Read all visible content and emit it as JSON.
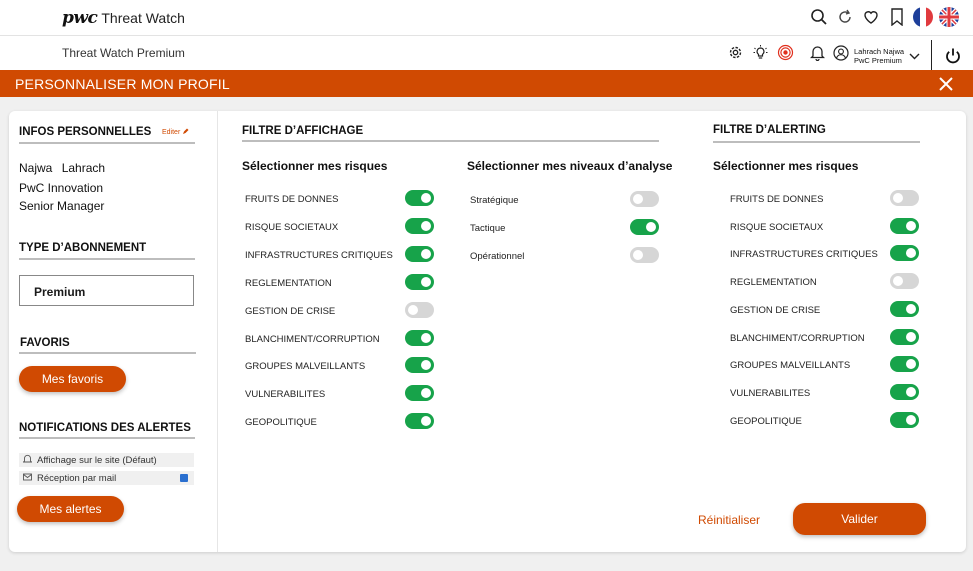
{
  "header": {
    "logo_mark": "pwc",
    "app_name": "Threat Watch",
    "icons": [
      "search-icon",
      "refresh-icon",
      "heart-icon",
      "bookmark-icon",
      "flag-fr-icon",
      "flag-uk-icon"
    ]
  },
  "subheader": {
    "title": "Threat Watch Premium",
    "icons": [
      "settings-icon",
      "lightbulb-icon",
      "target-icon",
      "bell-icon",
      "user-icon"
    ],
    "user_name": "Lahrach Najwa",
    "user_plan": "PwC Premium"
  },
  "modal": {
    "title": "PERSONNALISER MON PROFIL",
    "accent_color": "#d04a02"
  },
  "sidebar": {
    "infos_title": "INFOS PERSONNELLES",
    "edit_label": "Editer",
    "first_name": "Najwa",
    "last_name": "Lahrach",
    "company": "PwC Innovation",
    "role": "Senior Manager",
    "subscription_title": "TYPE D’ABONNEMENT",
    "subscription_value": "Premium",
    "favorites_title": "FAVORIS",
    "favorites_button": "Mes favoris",
    "notifications_title": "NOTIFICATIONS DES ALERTES",
    "notif_site": "Affichage sur le site (Défaut)",
    "notif_mail": "Réception par mail",
    "notif_mail_checked": true,
    "alerts_button": "Mes alertes"
  },
  "display_filter": {
    "title": "FILTRE D’AFFICHAGE",
    "risks_title": "Sélectionner mes risques",
    "risks": [
      {
        "label": "FRUITS DE DONNES",
        "on": true
      },
      {
        "label": "RISQUE SOCIETAUX",
        "on": true
      },
      {
        "label": "INFRASTRUCTURES CRITIQUES",
        "on": true
      },
      {
        "label": "REGLEMENTATION",
        "on": true
      },
      {
        "label": "GESTION DE CRISE",
        "on": false
      },
      {
        "label": "BLANCHIMENT/CORRUPTION",
        "on": true
      },
      {
        "label": "GROUPES MALVEILLANTS",
        "on": true
      },
      {
        "label": "VULNERABILITES",
        "on": true
      },
      {
        "label": "GEOPOLITIQUE",
        "on": true
      }
    ],
    "levels_title": "Sélectionner mes niveaux d’analyse",
    "levels": [
      {
        "label": "Stratégique",
        "on": false
      },
      {
        "label": "Tactique",
        "on": true
      },
      {
        "label": "Opérationnel",
        "on": false
      }
    ]
  },
  "alert_filter": {
    "title": "FILTRE D’ALERTING",
    "risks_title": "Sélectionner mes risques",
    "risks": [
      {
        "label": "FRUITS DE DONNES",
        "on": false
      },
      {
        "label": "RISQUE SOCIETAUX",
        "on": true
      },
      {
        "label": "INFRASTRUCTURES CRITIQUES",
        "on": true
      },
      {
        "label": "REGLEMENTATION",
        "on": false
      },
      {
        "label": "GESTION DE CRISE",
        "on": true
      },
      {
        "label": "BLANCHIMENT/CORRUPTION",
        "on": true
      },
      {
        "label": "GROUPES MALVEILLANTS",
        "on": true
      },
      {
        "label": "VULNERABILITES",
        "on": true
      },
      {
        "label": "GEOPOLITIQUE",
        "on": true
      }
    ]
  },
  "actions": {
    "reset_label": "Réinitialiser",
    "validate_label": "Valider"
  },
  "toggle_colors": {
    "on": "#17a34a",
    "off": "#d6d6d6"
  }
}
